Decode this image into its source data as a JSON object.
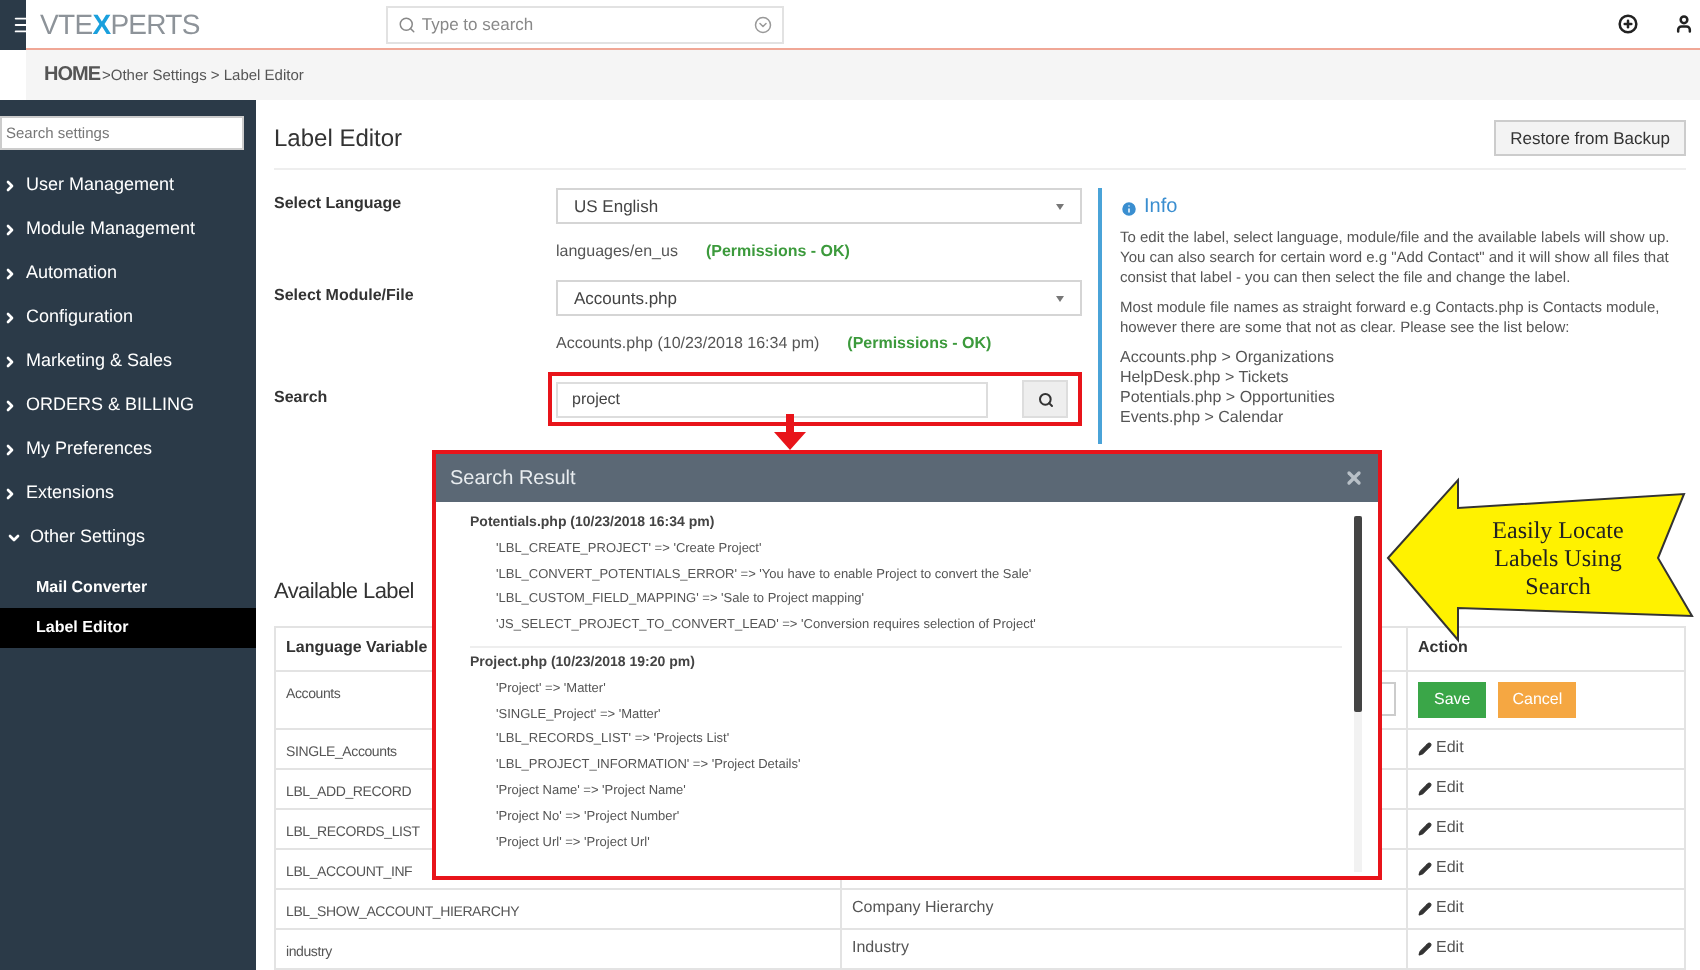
{
  "topbar": {
    "logo": {
      "prefix": "VTE",
      "mark": "X",
      "suffix": "PERTS"
    },
    "search": {
      "placeholder": "Type to search"
    }
  },
  "breadcrumb": {
    "home": "HOME",
    "trail": ">Other Settings > Label Editor"
  },
  "sidebar": {
    "search": {
      "placeholder": "Search settings"
    },
    "items": [
      {
        "label": "User Management",
        "expanded": false
      },
      {
        "label": "Module Management",
        "expanded": false
      },
      {
        "label": "Automation",
        "expanded": false
      },
      {
        "label": "Configuration",
        "expanded": false
      },
      {
        "label": "Marketing & Sales",
        "expanded": false
      },
      {
        "label": "ORDERS & BILLING",
        "expanded": false
      },
      {
        "label": "My Preferences",
        "expanded": false
      },
      {
        "label": "Extensions",
        "expanded": false
      },
      {
        "label": "Other Settings",
        "expanded": true,
        "children": [
          {
            "label": "Mail Converter",
            "selected": false
          },
          {
            "label": "Label Editor",
            "selected": true
          }
        ]
      }
    ]
  },
  "page": {
    "title": "Label Editor",
    "restore_button": "Restore from Backup"
  },
  "form": {
    "language": {
      "label": "Select Language",
      "value": "US English",
      "path": "languages/en_us",
      "permissions": "(Permissions - OK)"
    },
    "module": {
      "label": "Select Module/File",
      "value": "Accounts.php",
      "path": "Accounts.php (10/23/2018 16:34 pm)",
      "permissions": "(Permissions - OK)"
    },
    "search": {
      "label": "Search",
      "value": "project"
    }
  },
  "info": {
    "title": "Info",
    "paragraphs": [
      "To edit the label, select language, module/file and the available labels will show up. You can also search for certain word e.g \"Add Contact\" and it will show all files that consist that label - you can then select the file and change the label.",
      "Most module file names as straight forward e.g Contacts.php is Contacts module, however there are some that not as clear. Please see the list below:"
    ],
    "mappings": [
      "Accounts.php > Organizations",
      "HelpDesk.php > Tickets",
      "Potentials.php > Opportunities",
      "Events.php > Calendar"
    ]
  },
  "modal": {
    "title": "Search Result",
    "groups": [
      {
        "file": "Potentials.php (10/23/2018 16:34 pm)",
        "entries": [
          "'LBL_CREATE_PROJECT' => 'Create Project'",
          "'LBL_CONVERT_POTENTIALS_ERROR' => 'You have to enable Project to convert the Sale'",
          "'LBL_CUSTOM_FIELD_MAPPING' => 'Sale to Project mapping'",
          "'JS_SELECT_PROJECT_TO_CONVERT_LEAD' => 'Conversion requires selection of Project'"
        ]
      },
      {
        "file": "Project.php (10/23/2018 19:20 pm)",
        "entries": [
          "'Project' => 'Matter'",
          "'SINGLE_Project' => 'Matter'",
          "'LBL_RECORDS_LIST' => 'Projects List'",
          "'LBL_PROJECT_INFORMATION' => 'Project Details'",
          "'Project Name' => 'Project Name'",
          "'Project No' => 'Project Number'",
          "'Project Url' => 'Project Url'"
        ]
      }
    ]
  },
  "callout": {
    "text": "Easily Locate Labels Using Search"
  },
  "labels": {
    "title": "Available Label",
    "columns": {
      "column_1": "Language Variable",
      "column_3": "Action"
    },
    "rows": [
      {
        "kind": "editing",
        "variable": "Accounts",
        "save": "Save",
        "cancel": "Cancel"
      },
      {
        "kind": "view",
        "variable": "SINGLE_Accounts",
        "action": "Edit"
      },
      {
        "kind": "view",
        "variable": "LBL_ADD_RECORD",
        "action": "Edit"
      },
      {
        "kind": "view",
        "variable": "LBL_RECORDS_LIST",
        "action": "Edit"
      },
      {
        "kind": "view",
        "variable": "LBL_ACCOUNT_INF",
        "action": "Edit"
      },
      {
        "kind": "view",
        "variable": "LBL_SHOW_ACCOUNT_HIERARCHY",
        "value": "Company Hierarchy",
        "action": "Edit"
      },
      {
        "kind": "view",
        "variable": "industry",
        "value": "Industry",
        "action": "Edit"
      }
    ]
  }
}
